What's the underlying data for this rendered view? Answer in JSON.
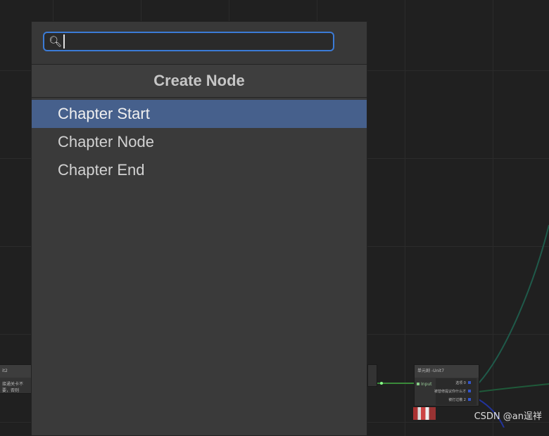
{
  "search": {
    "value": "",
    "placeholder": ""
  },
  "panel": {
    "title": "Create Node",
    "items": [
      {
        "label": "Chapter Start",
        "selected": true
      },
      {
        "label": "Chapter Node",
        "selected": false
      },
      {
        "label": "Chapter End",
        "selected": false
      }
    ]
  },
  "background_nodes": {
    "left": {
      "title": "it2",
      "text": "接通关卡不要，否则"
    },
    "right": {
      "title": "单元剧 -Unit7",
      "input_label": "Input",
      "outputs": [
        "选项 0",
        "被替修提议你什么才",
        "被打过散 2"
      ]
    }
  },
  "watermark": "CSDN @an逞祥",
  "colors": {
    "accent": "#3b7bd6",
    "selection": "#46608c",
    "wire_green": "#3a8a3a",
    "wire_blue": "#22339a"
  },
  "icons": {
    "search": "search-icon"
  }
}
